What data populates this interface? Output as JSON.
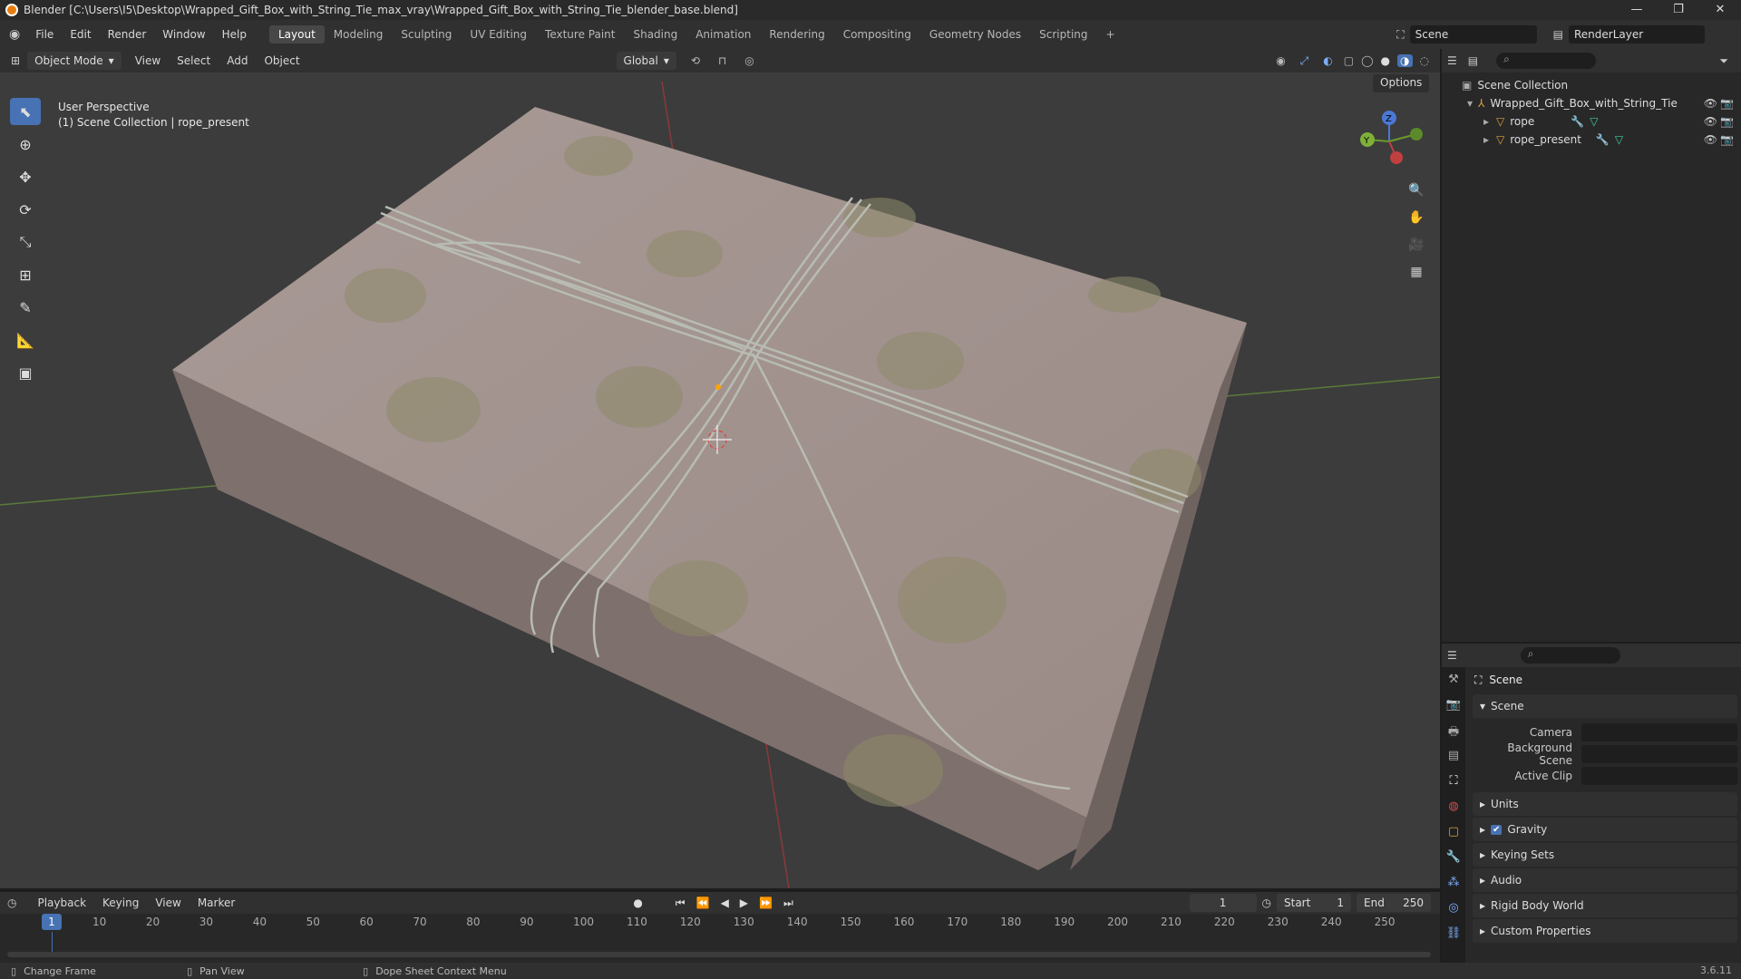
{
  "window": {
    "title": "Blender [C:\\Users\\I5\\Desktop\\Wrapped_Gift_Box_with_String_Tie_max_vray\\Wrapped_Gift_Box_with_String_Tie_blender_base.blend]",
    "controls": [
      "—",
      "❐",
      "✕"
    ]
  },
  "topbar": {
    "menus": [
      "File",
      "Edit",
      "Render",
      "Window",
      "Help"
    ],
    "workspaces": [
      "Layout",
      "Modeling",
      "Sculpting",
      "UV Editing",
      "Texture Paint",
      "Shading",
      "Animation",
      "Rendering",
      "Compositing",
      "Geometry Nodes",
      "Scripting",
      "+"
    ],
    "active_workspace": "Layout",
    "scene": "Scene",
    "render_layer": "RenderLayer"
  },
  "viewport_header": {
    "mode": "Object Mode",
    "menus": [
      "View",
      "Select",
      "Add",
      "Object"
    ],
    "transform": "Global",
    "options": "Options"
  },
  "viewport": {
    "perspective": "User Perspective",
    "collection_info": "(1) Scene Collection | rope_present"
  },
  "gizmo": {
    "z": "Z",
    "y": "Y"
  },
  "outliner": {
    "root": "Scene Collection",
    "collection": "Wrapped_Gift_Box_with_String_Tie",
    "items": [
      "rope",
      "rope_present"
    ]
  },
  "properties": {
    "title": "Scene",
    "section": "Scene",
    "fields": [
      "Camera",
      "Background Scene",
      "Active Clip"
    ],
    "panels": [
      "Units",
      "Gravity",
      "Keying Sets",
      "Audio",
      "Rigid Body World",
      "Custom Properties"
    ]
  },
  "timeline": {
    "menus": [
      "Playback",
      "Keying",
      "View",
      "Marker"
    ],
    "current_frame": "1",
    "start_label": "Start",
    "start": "1",
    "end_label": "End",
    "end": "250",
    "ticks": [
      "1",
      "10",
      "20",
      "30",
      "40",
      "50",
      "60",
      "70",
      "80",
      "90",
      "100",
      "110",
      "120",
      "130",
      "140",
      "150",
      "160",
      "170",
      "180",
      "190",
      "200",
      "210",
      "220",
      "230",
      "240",
      "250"
    ]
  },
  "status": {
    "items": [
      "Change Frame",
      "Pan View",
      "Dope Sheet Context Menu"
    ],
    "version": "3.6.11"
  }
}
